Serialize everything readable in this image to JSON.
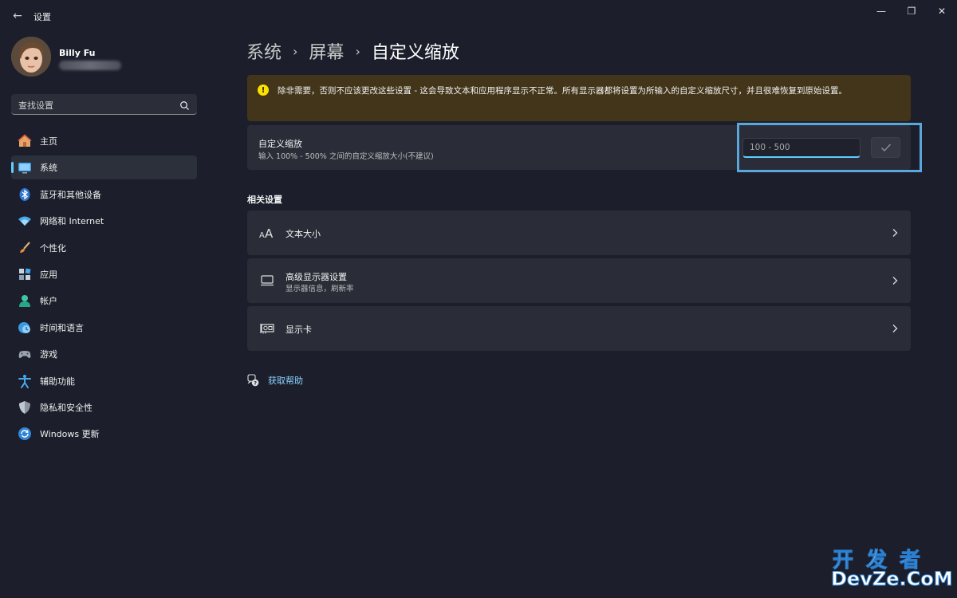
{
  "window": {
    "title": "设置",
    "back_glyph": "←",
    "minimize_glyph": "—",
    "maximize_glyph": "❐",
    "close_glyph": "✕"
  },
  "user": {
    "name": "Billy Fu"
  },
  "search": {
    "placeholder": "查找设置"
  },
  "sidebar": {
    "items": [
      {
        "label": "主页",
        "icon": "home-icon"
      },
      {
        "label": "系统",
        "icon": "system-icon",
        "active": true
      },
      {
        "label": "蓝牙和其他设备",
        "icon": "bluetooth-icon"
      },
      {
        "label": "网络和 Internet",
        "icon": "wifi-icon"
      },
      {
        "label": "个性化",
        "icon": "brush-icon"
      },
      {
        "label": "应用",
        "icon": "apps-icon"
      },
      {
        "label": "帐户",
        "icon": "account-icon"
      },
      {
        "label": "时间和语言",
        "icon": "time-language-icon"
      },
      {
        "label": "游戏",
        "icon": "gamepad-icon"
      },
      {
        "label": "辅助功能",
        "icon": "accessibility-icon"
      },
      {
        "label": "隐私和安全性",
        "icon": "shield-icon"
      },
      {
        "label": "Windows 更新",
        "icon": "update-icon"
      }
    ]
  },
  "breadcrumb": {
    "items": [
      "系统",
      "屏幕"
    ],
    "current": "自定义缩放",
    "separator": "›"
  },
  "warning": {
    "icon_glyph": "!",
    "text": "除非需要，否则不应该更改这些设置 - 这会导致文本和应用程序显示不正常。所有显示器都将设置为所输入的自定义缩放尺寸，并且很难恢复到原始设置。"
  },
  "custom_scale": {
    "title": "自定义缩放",
    "subtitle": "输入 100% - 500% 之间的自定义缩放大小(不建议)",
    "input_value": "",
    "input_placeholder": "100 - 500"
  },
  "related": {
    "title": "相关设置",
    "rows": [
      {
        "title": "文本大小",
        "subtitle": "",
        "icon": "text-size-icon"
      },
      {
        "title": "高级显示器设置",
        "subtitle": "显示器信息，刷新率",
        "icon": "monitor-icon"
      },
      {
        "title": "显示卡",
        "subtitle": "",
        "icon": "graphics-card-icon"
      }
    ]
  },
  "help": {
    "label": "获取帮助"
  },
  "watermark": {
    "cn": "开发者",
    "en": "DevZe.CoM"
  },
  "colors": {
    "accent": "#60cdff",
    "warning_bg": "#433519",
    "warning_icon": "#fce100",
    "background": "#1c1f2b",
    "card": "#2a2d38",
    "highlight_box": "#5aa7dd"
  }
}
